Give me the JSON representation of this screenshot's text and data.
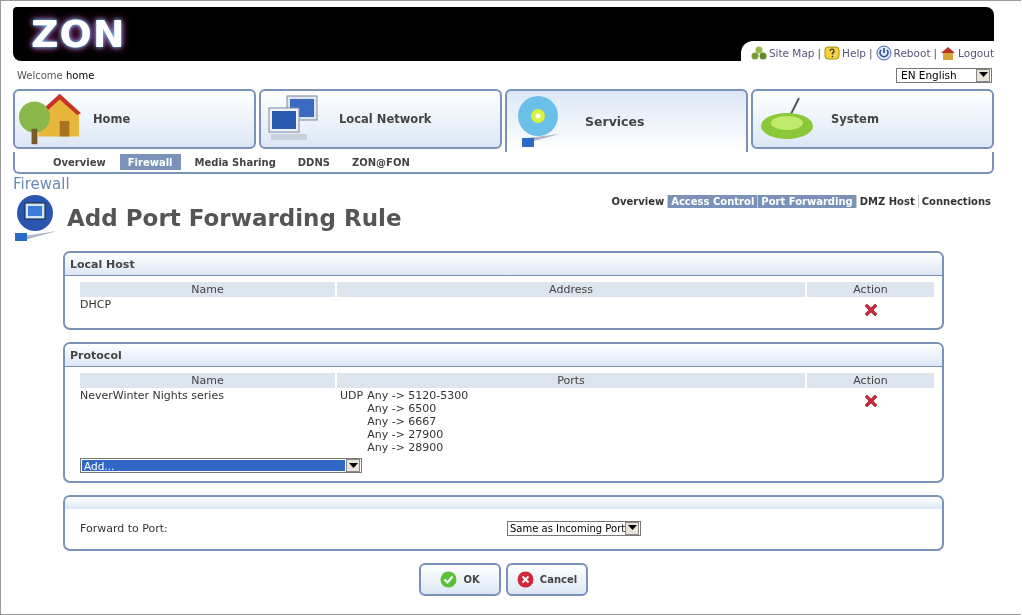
{
  "header": {
    "logo": "ZON",
    "links": [
      {
        "kind": "sitemap",
        "label": "Site Map"
      },
      {
        "kind": "help",
        "label": "Help"
      },
      {
        "kind": "reboot",
        "label": "Reboot"
      },
      {
        "kind": "logout",
        "label": "Logout"
      }
    ],
    "separator": "|"
  },
  "welcome": {
    "label": "Welcome",
    "user": "home"
  },
  "language": {
    "value": "EN English"
  },
  "main_tabs": [
    {
      "kind": "home",
      "label": "Home",
      "selected": false
    },
    {
      "kind": "network",
      "label": "Local Network",
      "selected": false
    },
    {
      "kind": "services",
      "label": "Services",
      "selected": true
    },
    {
      "kind": "system",
      "label": "System",
      "selected": false
    }
  ],
  "sub_tabs": [
    {
      "label": "Overview",
      "selected": false
    },
    {
      "label": "Firewall",
      "selected": true
    },
    {
      "label": "Media Sharing",
      "selected": false
    },
    {
      "label": "DDNS",
      "selected": false
    },
    {
      "label": "ZON@FON",
      "selected": false
    }
  ],
  "section": "Firewall",
  "page_title": "Add Port Forwarding Rule",
  "page_links": [
    {
      "label": "Overview",
      "highlighted": false
    },
    {
      "label": "Access Control",
      "highlighted": true
    },
    {
      "label": "Port Forwarding",
      "highlighted": true
    },
    {
      "label": "DMZ Host",
      "highlighted": false
    },
    {
      "label": "Connections",
      "highlighted": false
    }
  ],
  "local_host": {
    "title": "Local Host",
    "columns": [
      "Name",
      "Address",
      "Action"
    ],
    "rows": [
      {
        "name": "DHCP"
      }
    ]
  },
  "protocol": {
    "title": "Protocol",
    "columns": [
      "Name",
      "Ports",
      "Action"
    ],
    "rows": [
      {
        "name": "NeverWinter Nights series",
        "protocol": "UDP",
        "ports": [
          "Any -> 5120-5300",
          "Any -> 6500",
          "Any -> 6667",
          "Any -> 27900",
          "Any -> 28900"
        ]
      }
    ],
    "add_select": "Add..."
  },
  "forward": {
    "label": "Forward to Port:",
    "value": "Same as Incoming Port"
  },
  "buttons": [
    {
      "kind": "ok",
      "label": "OK"
    },
    {
      "kind": "cancel",
      "label": "Cancel"
    }
  ]
}
